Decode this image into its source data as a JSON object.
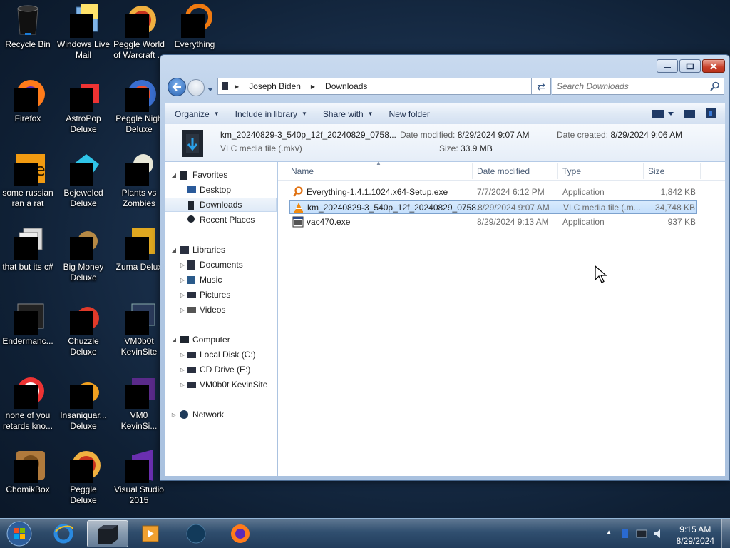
{
  "desktop": {
    "icons": [
      {
        "label": "Recycle Bin",
        "icon": "recycle-bin-icon"
      },
      {
        "label": "Windows Live\nMail",
        "icon": "mail-icon"
      },
      {
        "label": "Peggle World\nof Warcraft ...",
        "icon": "peggle-icon"
      },
      {
        "label": "Everything",
        "icon": "everything-icon"
      },
      {
        "label": "Firefox",
        "icon": "firefox-icon"
      },
      {
        "label": "AstroPop\nDeluxe",
        "icon": "astropop-icon"
      },
      {
        "label": "Peggle Nigh\nDeluxe",
        "icon": "peggle-nights-icon"
      },
      {
        "label": "some russian\nran a rat",
        "icon": "app-icon"
      },
      {
        "label": "Bejeweled\nDeluxe",
        "icon": "bejeweled-icon"
      },
      {
        "label": "Plants vs\nZombies",
        "icon": "plants-vs-zombies-icon"
      },
      {
        "label": "that but its c#",
        "icon": "app-icon"
      },
      {
        "label": "Big Money\nDeluxe",
        "icon": "big-money-icon"
      },
      {
        "label": "Zuma Delux",
        "icon": "zuma-icon"
      },
      {
        "label": "Endermanc...",
        "icon": "app-icon"
      },
      {
        "label": "Chuzzle\nDeluxe",
        "icon": "chuzzle-icon"
      },
      {
        "label": "VM0b0t\nKevinSite",
        "icon": "app-icon"
      },
      {
        "label": "none of you\nretards kno...",
        "icon": "app-icon"
      },
      {
        "label": "Insaniquar...\nDeluxe",
        "icon": "insaniquarium-icon"
      },
      {
        "label": "VM0\nKevinSi...",
        "icon": "app-icon"
      },
      {
        "label": "ChomikBox",
        "icon": "chomikbox-icon"
      },
      {
        "label": "Peggle Deluxe",
        "icon": "peggle-icon"
      },
      {
        "label": "Visual Studio\n2015",
        "icon": "visual-studio-icon"
      }
    ]
  },
  "explorer": {
    "breadcrumb": [
      "Joseph Biden",
      "Downloads"
    ],
    "search_placeholder": "Search Downloads",
    "commands": [
      "Organize",
      "Include in library",
      "Share with",
      "New folder"
    ],
    "details": {
      "filename": "km_20240829-3_540p_12f_20240829_0758...",
      "filetype": "VLC media file (.mkv)",
      "date_modified_label": "Date modified:",
      "date_modified": "8/29/2024 9:07 AM",
      "size_label": "Size:",
      "size": "33.9 MB",
      "date_created_label": "Date created:",
      "date_created": "8/29/2024 9:06 AM"
    },
    "nav": {
      "favorites": "Favorites",
      "desktop": "Desktop",
      "downloads": "Downloads",
      "recent": "Recent Places",
      "libraries": "Libraries",
      "documents": "Documents",
      "music": "Music",
      "pictures": "Pictures",
      "videos": "Videos",
      "computer": "Computer",
      "local_disk": "Local Disk (C:)",
      "cd_drive": "CD Drive (E:)",
      "vm_site": "VM0b0t KevinSite",
      "network": "Network"
    },
    "columns": {
      "name": "Name",
      "date": "Date modified",
      "type": "Type",
      "size": "Size"
    },
    "files": [
      {
        "name": "Everything-1.4.1.1024.x64-Setup.exe",
        "date": "7/7/2024 6:12 PM",
        "type": "Application",
        "size": "1,842 KB"
      },
      {
        "name": "km_20240829-3_540p_12f_20240829_0758...",
        "date": "8/29/2024 9:07 AM",
        "type": "VLC media file (.m...",
        "size": "34,748 KB"
      },
      {
        "name": "vac470.exe",
        "date": "8/29/2024 9:13 AM",
        "type": "Application",
        "size": "937 KB"
      }
    ]
  },
  "taskbar": {
    "time": "9:15 AM",
    "date": "8/29/2024",
    "tray_up": "▲"
  }
}
